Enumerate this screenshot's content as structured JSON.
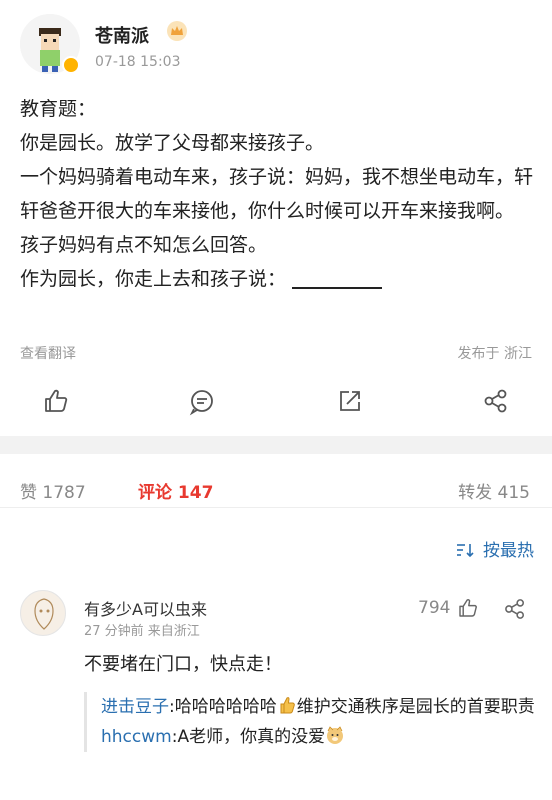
{
  "post": {
    "author": "苍南派",
    "time": "07-18 15:03",
    "lines": [
      "教育题：",
      "你是园长。放学了父母都来接孩子。",
      "一个妈妈骑着电动车来，孩子说：妈妈，我不想坐电动车，轩轩爸爸开很大的车来接他，你什么时候可以开车来接我啊。",
      "孩子妈妈有点不知怎么回答。",
      "作为园长，你走上去和孩子说："
    ],
    "translate_label": "查看翻译",
    "location": "发布于 浙江",
    "icons": [
      "thumbs-up-icon",
      "comment-icon",
      "repost-icon",
      "share-icon"
    ]
  },
  "stats": {
    "like_label": "赞",
    "like_count": "1787",
    "comment_label": "评论",
    "comment_count": "147",
    "repost_label": "转发",
    "repost_count": "415"
  },
  "sort": {
    "label": "按最热"
  },
  "comment": {
    "user": "有多少A可以虫来",
    "time": "27 分钟前  来自浙江",
    "likes": "794",
    "text": "不要堵在门口，快点走！",
    "replies": [
      {
        "user": "进击豆子",
        "sep": ":",
        "text_before": "哈哈哈哈哈哈",
        "text_after": "维护交通秩序是园长的首要职责"
      },
      {
        "user": "hhccwm",
        "sep": ":",
        "text": "A老师，你真的没爱"
      }
    ]
  },
  "colors": {
    "accent_red": "#e8392f",
    "link_blue": "#2a6fb0",
    "muted": "#999999"
  }
}
